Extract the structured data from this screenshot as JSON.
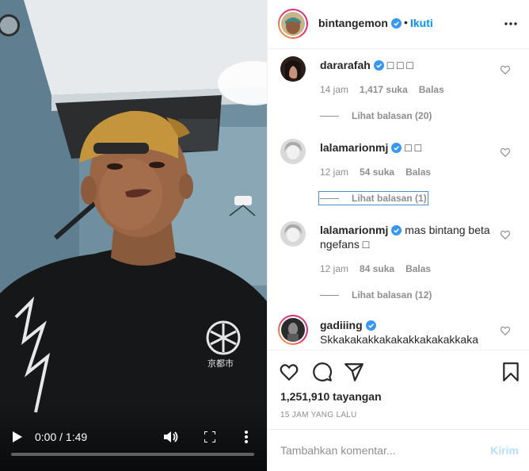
{
  "video": {
    "time": "0:00 / 1:49",
    "progress": 0.0,
    "controls": {
      "play_icon": "play-icon",
      "volume_icon": "volume-icon",
      "fullscreen_icon": "fullscreen-icon",
      "more_icon": "more-vertical-icon"
    },
    "shirt_text": "京都市"
  },
  "header": {
    "username": "bintangemon",
    "verified": true,
    "separator": "•",
    "follow_label": "Ikuti",
    "more_icon": "more-horizontal-icon"
  },
  "comments": [
    {
      "username": "dararafah",
      "verified": true,
      "text": "□ □ □",
      "time": "14 jam",
      "likes": "1,417 suka",
      "reply_label": "Balas",
      "view_replies": "Lihat balasan (20)"
    },
    {
      "username": "lalamarionmj",
      "verified": true,
      "text": "□ □",
      "time": "12 jam",
      "likes": "54 suka",
      "reply_label": "Balas",
      "view_replies": "Lihat balasan (1)"
    },
    {
      "username": "lalamarionmj",
      "verified": true,
      "text": "mas bintang beta ngefans □",
      "time": "12 jam",
      "likes": "84 suka",
      "reply_label": "Balas",
      "view_replies": "Lihat balasan (12)"
    },
    {
      "username": "gadiiing",
      "verified": true,
      "text": "Skkakakakkakakakkakakakkaka"
    }
  ],
  "actions": {
    "like_icon": "heart-icon",
    "comment_icon": "comment-icon",
    "share_icon": "share-icon",
    "save_icon": "bookmark-icon",
    "views": "1,251,910 tayangan",
    "timeago": "15 JAM YANG LALU"
  },
  "add_comment": {
    "placeholder": "Tambahkan komentar...",
    "post_label": "Kirim"
  },
  "colors": {
    "accent": "#0095f6",
    "accent_disabled": "#b2dffc",
    "verified": "#3897f0",
    "muted": "#8e8e8e"
  }
}
